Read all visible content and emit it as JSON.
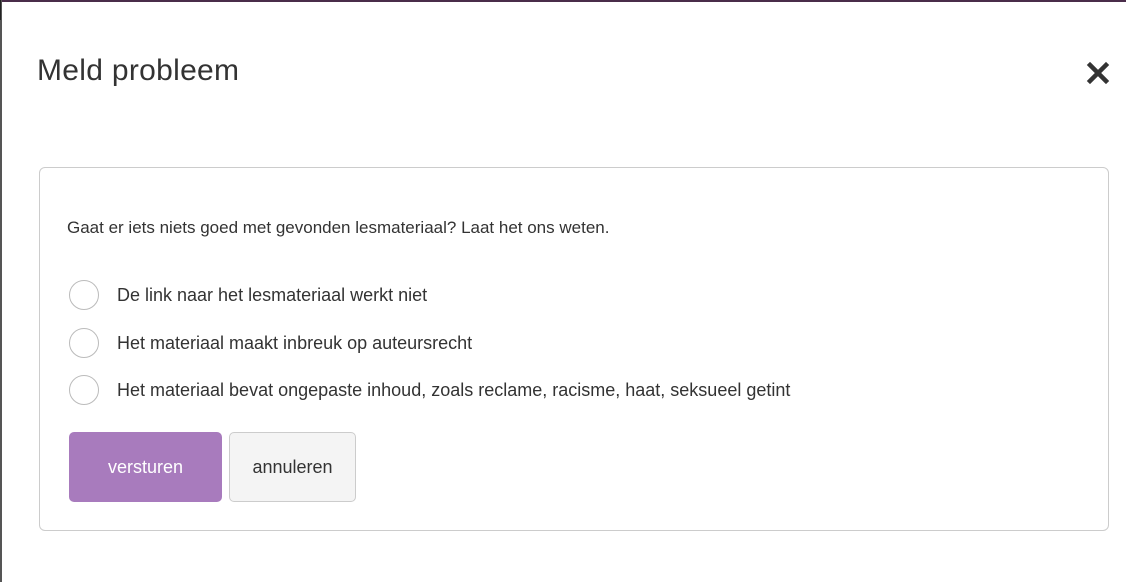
{
  "modal": {
    "title": "Meld probleem",
    "close_icon": "close-icon"
  },
  "form": {
    "intro": "Gaat er iets niets goed met gevonden lesmateriaal? Laat het ons weten.",
    "options": [
      {
        "label": "De link naar het lesmateriaal werkt niet",
        "selected": false
      },
      {
        "label": "Het materiaal maakt inbreuk op auteursrecht",
        "selected": false
      },
      {
        "label": "Het materiaal bevat ongepaste inhoud, zoals reclame, racisme, haat, seksueel getint",
        "selected": false
      }
    ],
    "submit_label": "versturen",
    "cancel_label": "annuleren"
  },
  "colors": {
    "primary": "#a87bbd",
    "text": "#333333",
    "border": "#cccccc"
  }
}
